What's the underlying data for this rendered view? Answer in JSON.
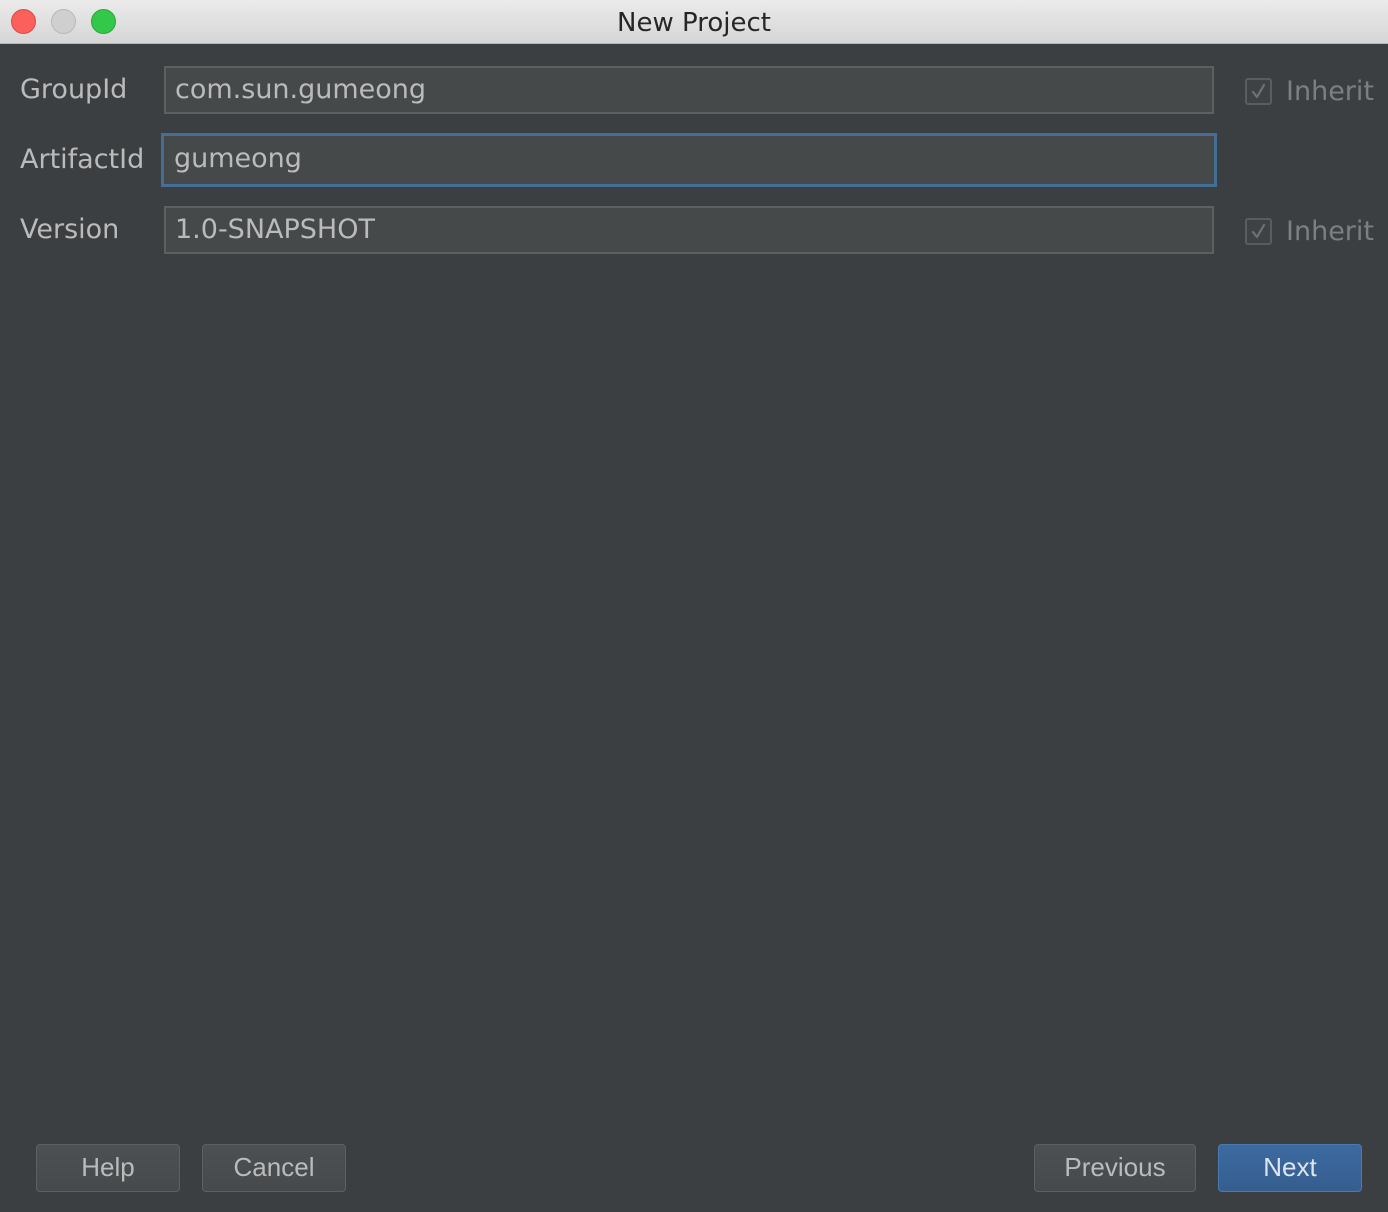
{
  "window": {
    "title": "New Project"
  },
  "form": {
    "group_id": {
      "label": "GroupId",
      "value": "com.sun.gumeong",
      "inherit_label": "Inherit",
      "inherit_checked": true
    },
    "artifact_id": {
      "label": "ArtifactId",
      "value": "gumeong"
    },
    "version": {
      "label": "Version",
      "value": "1.0-SNAPSHOT",
      "inherit_label": "Inherit",
      "inherit_checked": true
    }
  },
  "buttons": {
    "help": "Help",
    "cancel": "Cancel",
    "previous": "Previous",
    "next": "Next"
  },
  "colors": {
    "background": "#3c3f41",
    "field_background": "#45494a",
    "focus_border": "#466d94",
    "primary_button": "#365e8f"
  }
}
